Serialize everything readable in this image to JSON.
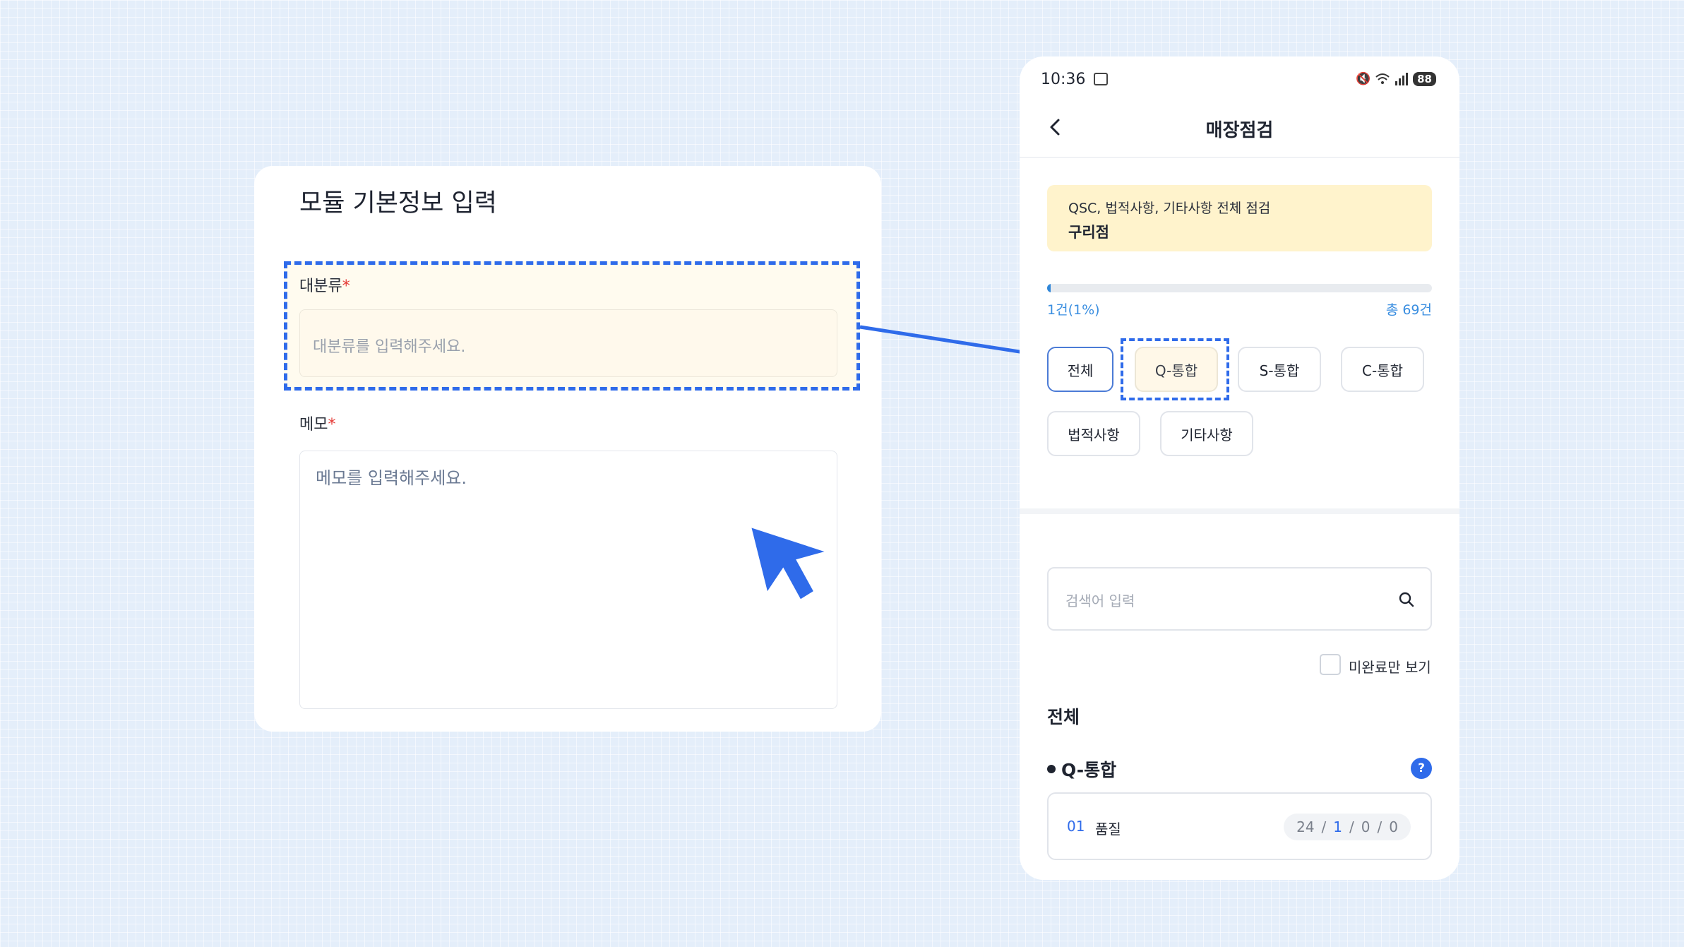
{
  "form": {
    "title": "모듈 기본정보 입력",
    "major_label": "대분류",
    "major_placeholder": "대분류를 입력해주세요.",
    "memo_label": "메모",
    "memo_placeholder": "메모를 입력해주세요.",
    "required_mark": "*"
  },
  "phone": {
    "status": {
      "time": "10:36",
      "battery": "88"
    },
    "nav": {
      "title": "매장점검"
    },
    "notice": {
      "line1": "QSC, 법적사항, 기타사항 전체 점검",
      "line2": "구리점"
    },
    "progress": {
      "done_label": "1건(1%)",
      "total_label": "총 69건",
      "fraction": 0.01
    },
    "chips": [
      "전체",
      "Q-통합",
      "S-통합",
      "C-통합",
      "법적사항",
      "기타사항"
    ],
    "search": {
      "placeholder": "검색어 입력"
    },
    "filter": {
      "incomplete_label": "미완료만 보기"
    },
    "section_title": "전체",
    "group": {
      "title": "Q-통합",
      "help": "?"
    },
    "item": {
      "no": "01",
      "name": "품질",
      "stat_total": "24",
      "stat_done": "1",
      "stat_a": "0",
      "stat_b": "0",
      "sep": "/"
    }
  },
  "colors": {
    "accent": "#2f6bea",
    "notice_bg": "#fff3cc",
    "highlight_bg": "#fffbef"
  }
}
